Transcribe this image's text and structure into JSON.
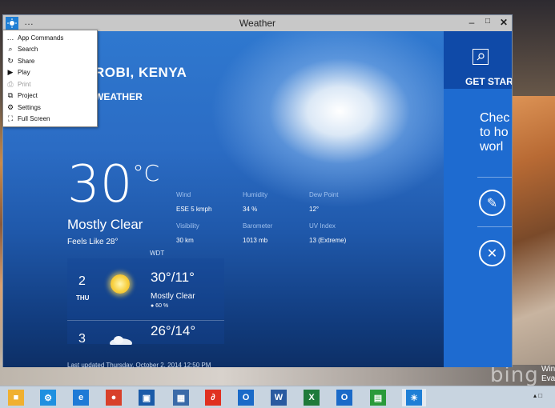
{
  "window": {
    "title": "Weather",
    "menu_dots": "…",
    "minimize": "–",
    "maximize": "□",
    "close": "✕"
  },
  "menu": {
    "items": [
      {
        "label": "App Commands",
        "icon": "more-icon",
        "glyph": "…",
        "disabled": false
      },
      {
        "label": "Search",
        "icon": "search-icon",
        "glyph": "⌕",
        "disabled": false
      },
      {
        "label": "Share",
        "icon": "share-icon",
        "glyph": "↻",
        "disabled": false
      },
      {
        "label": "Play",
        "icon": "play-icon",
        "glyph": "▶",
        "disabled": false
      },
      {
        "label": "Print",
        "icon": "print-icon",
        "glyph": "⎙",
        "disabled": true
      },
      {
        "label": "Project",
        "icon": "project-icon",
        "glyph": "⧉",
        "disabled": false
      },
      {
        "label": "Settings",
        "icon": "gear-icon",
        "glyph": "⚙",
        "disabled": false
      },
      {
        "label": "Full Screen",
        "icon": "fullscreen-icon",
        "glyph": "⛶",
        "disabled": false
      }
    ]
  },
  "weather": {
    "city": "ROBI, KENYA",
    "subtitle": "WEATHER",
    "temp": "30",
    "unit": "°C",
    "condition": "Mostly Clear",
    "feels_like": "Feels Like 28°",
    "details": {
      "wind_label": "Wind",
      "wind": "ESE 5 kmph",
      "humidity_label": "Humidity",
      "humidity": "34 %",
      "dew_label": "Dew Point",
      "dew": "12°",
      "visibility_label": "Visibility",
      "visibility": "30 km",
      "barometer_label": "Barometer",
      "barometer": "1013 mb",
      "uv_label": "UV Index",
      "uv": "13 (Extreme)"
    },
    "source": "WDT",
    "forecast": [
      {
        "day": "2",
        "dow": "THU",
        "hilo": "30°/11°",
        "cond": "Mostly Clear",
        "precip": "● 60 %"
      },
      {
        "day": "3",
        "hilo": "26°/14°"
      }
    ],
    "updated": "Last updated Thursday, October 2, 2014 12:50 PM"
  },
  "sidebar": {
    "get_started": "GET STAR",
    "text_lines": [
      "Chec",
      "to ho",
      "worl"
    ],
    "edit_glyph": "✎",
    "close_glyph": "✕"
  },
  "desktop": {
    "bing": "bing",
    "watermark1": "Win",
    "watermark2": "Eval"
  },
  "taskbar": {
    "apps": [
      {
        "name": "file-explorer-icon",
        "color": "#f0b030",
        "glyph": "■"
      },
      {
        "name": "settings-app-icon",
        "color": "#1e90e0",
        "glyph": "⚙"
      },
      {
        "name": "ie-icon",
        "color": "#1e7ad6",
        "glyph": "e"
      },
      {
        "name": "chrome-icon",
        "color": "#d8402a",
        "glyph": "●"
      },
      {
        "name": "photo-app-icon",
        "color": "#1a5aa8",
        "glyph": "▣"
      },
      {
        "name": "calculator-icon",
        "color": "#3a6aa8",
        "glyph": "▦"
      },
      {
        "name": "acrobat-icon",
        "color": "#e03020",
        "glyph": "∂"
      },
      {
        "name": "outlook-icon",
        "color": "#1a6ac8",
        "glyph": "O"
      },
      {
        "name": "word-icon",
        "color": "#2a5aa0",
        "glyph": "W"
      },
      {
        "name": "excel-icon",
        "color": "#1e7a3a",
        "glyph": "X"
      },
      {
        "name": "outlook2-icon",
        "color": "#1a6ac8",
        "glyph": "O"
      },
      {
        "name": "store-icon",
        "color": "#2a9a3a",
        "glyph": "▤"
      },
      {
        "name": "weather-app-icon",
        "color": "#1e7fd6",
        "glyph": "☀"
      }
    ],
    "tray": "▴  □"
  }
}
